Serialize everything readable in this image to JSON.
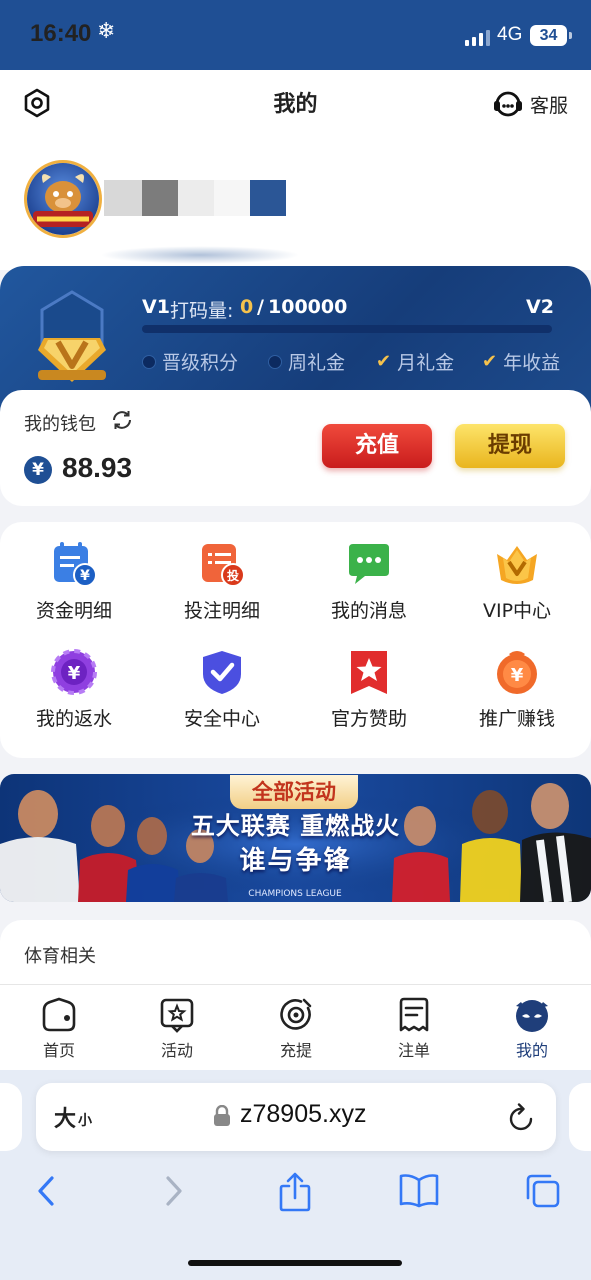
{
  "status": {
    "time": "16:40",
    "network": "4G",
    "battery": "34"
  },
  "header": {
    "title": "我的",
    "service_label": "客服"
  },
  "vip": {
    "current_level": "V1",
    "code_label": "打码量:",
    "current": "0",
    "separator": "/",
    "target": "100000",
    "progress": 0,
    "next_level": "V2",
    "perks": [
      {
        "label": "晋级积分",
        "checked": false
      },
      {
        "label": "周礼金",
        "checked": false
      },
      {
        "label": "月礼金",
        "checked": true
      },
      {
        "label": "年收益",
        "checked": true
      }
    ]
  },
  "wallet": {
    "label": "我的钱包",
    "currency_symbol": "¥",
    "balance": "88.93",
    "recharge_label": "充值",
    "withdraw_label": "提现"
  },
  "grid": {
    "items": [
      {
        "label": "资金明细",
        "icon": "fund-detail-icon"
      },
      {
        "label": "投注明细",
        "icon": "bet-detail-icon"
      },
      {
        "label": "我的消息",
        "icon": "message-icon"
      },
      {
        "label": "VIP中心",
        "icon": "vip-crown-icon"
      },
      {
        "label": "我的返水",
        "icon": "rebate-icon"
      },
      {
        "label": "安全中心",
        "icon": "shield-icon"
      },
      {
        "label": "官方赞助",
        "icon": "sponsor-star-icon"
      },
      {
        "label": "推广赚钱",
        "icon": "promo-money-icon"
      }
    ]
  },
  "banner": {
    "tag": "全部活动",
    "line1": "五大联赛 重燃战火",
    "line2": "谁与争锋",
    "badge": "CHAMPIONS LEAGUE"
  },
  "sports": {
    "label": "体育相关"
  },
  "tabbar": {
    "items": [
      {
        "label": "首页",
        "icon": "home-icon"
      },
      {
        "label": "活动",
        "icon": "activity-icon"
      },
      {
        "label": "充提",
        "icon": "deposit-icon"
      },
      {
        "label": "注单",
        "icon": "orders-icon"
      },
      {
        "label": "我的",
        "icon": "mine-icon",
        "active": true
      }
    ]
  },
  "browser": {
    "text_size": "大",
    "text_size_small": "小",
    "url": "z78905.xyz"
  },
  "colors": {
    "primary": "#1f4f94",
    "gold": "#f5c24c",
    "red": "#d42b22"
  }
}
